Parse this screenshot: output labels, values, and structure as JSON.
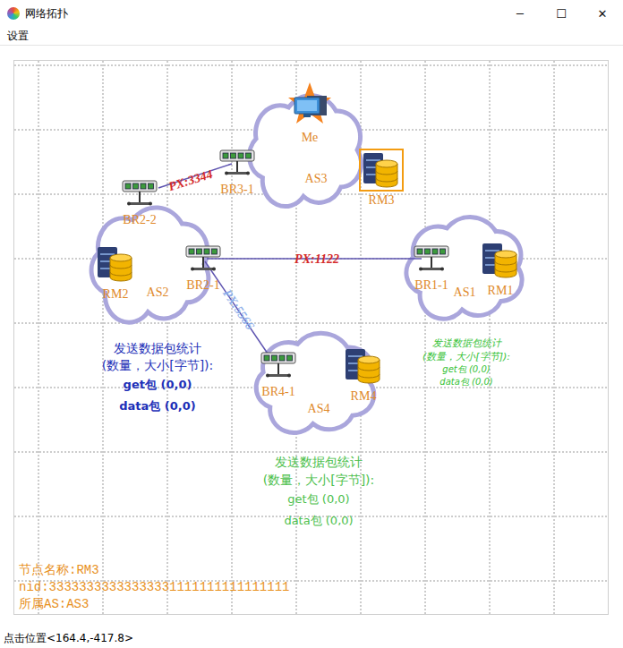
{
  "window": {
    "title": "网络拓扑",
    "controls": [
      "─",
      "☐",
      "✕"
    ]
  },
  "menu": [
    "设置"
  ],
  "clouds": [
    {
      "label": "AS3"
    },
    {
      "label": "AS2"
    },
    {
      "label": "AS1"
    },
    {
      "label": "AS4"
    }
  ],
  "nodes": [
    {
      "label": "Me",
      "kind": "host",
      "selected": false
    },
    {
      "label": "RM3",
      "kind": "server",
      "selected": true
    },
    {
      "label": "BR3-1",
      "kind": "router",
      "selected": false
    },
    {
      "label": "BR2-2",
      "kind": "router",
      "selected": false
    },
    {
      "label": "RM2",
      "kind": "server",
      "selected": false
    },
    {
      "label": "BR2-1",
      "kind": "router",
      "selected": false
    },
    {
      "label": "BR1-1",
      "kind": "router",
      "selected": false
    },
    {
      "label": "RM1",
      "kind": "server",
      "selected": false
    },
    {
      "label": "BR4-1",
      "kind": "router",
      "selected": false
    },
    {
      "label": "RM4",
      "kind": "server",
      "selected": false
    }
  ],
  "links": [
    {
      "label": "PX:3344",
      "color": "#d42a2a"
    },
    {
      "label": "PX:1122",
      "color": "#d42a2a"
    },
    {
      "label": "PX:5566",
      "color": "#8fb0ea"
    }
  ],
  "stats": [
    {
      "lines": [
        "发送数据包统计",
        "(数量，大小[字节]):"
      ],
      "rows": [
        "get包 (0,0)",
        "data包 (0,0)"
      ],
      "color": "#1c2fb8",
      "kind": "bold"
    },
    {
      "lines": [
        "发送数据包统计",
        "(数量，大小[字节]):"
      ],
      "rows": [
        "get包 (0,0)",
        "data包 (0,0)"
      ],
      "color": "#36c236",
      "kind": "compact"
    },
    {
      "lines": [
        "发送数据包统计",
        "(数量，大小[字节]):"
      ],
      "rows": [
        "get包 (0,0)",
        "data包 (0,0)"
      ],
      "color": "#4cbf4c",
      "kind": "plain"
    }
  ],
  "info": {
    "lines": [
      "节点名称:RM3",
      "nid:33333333333333331111111111111111",
      "所属AS:AS3"
    ]
  },
  "status_bar": "点击位置<164.4,-417.8>"
}
